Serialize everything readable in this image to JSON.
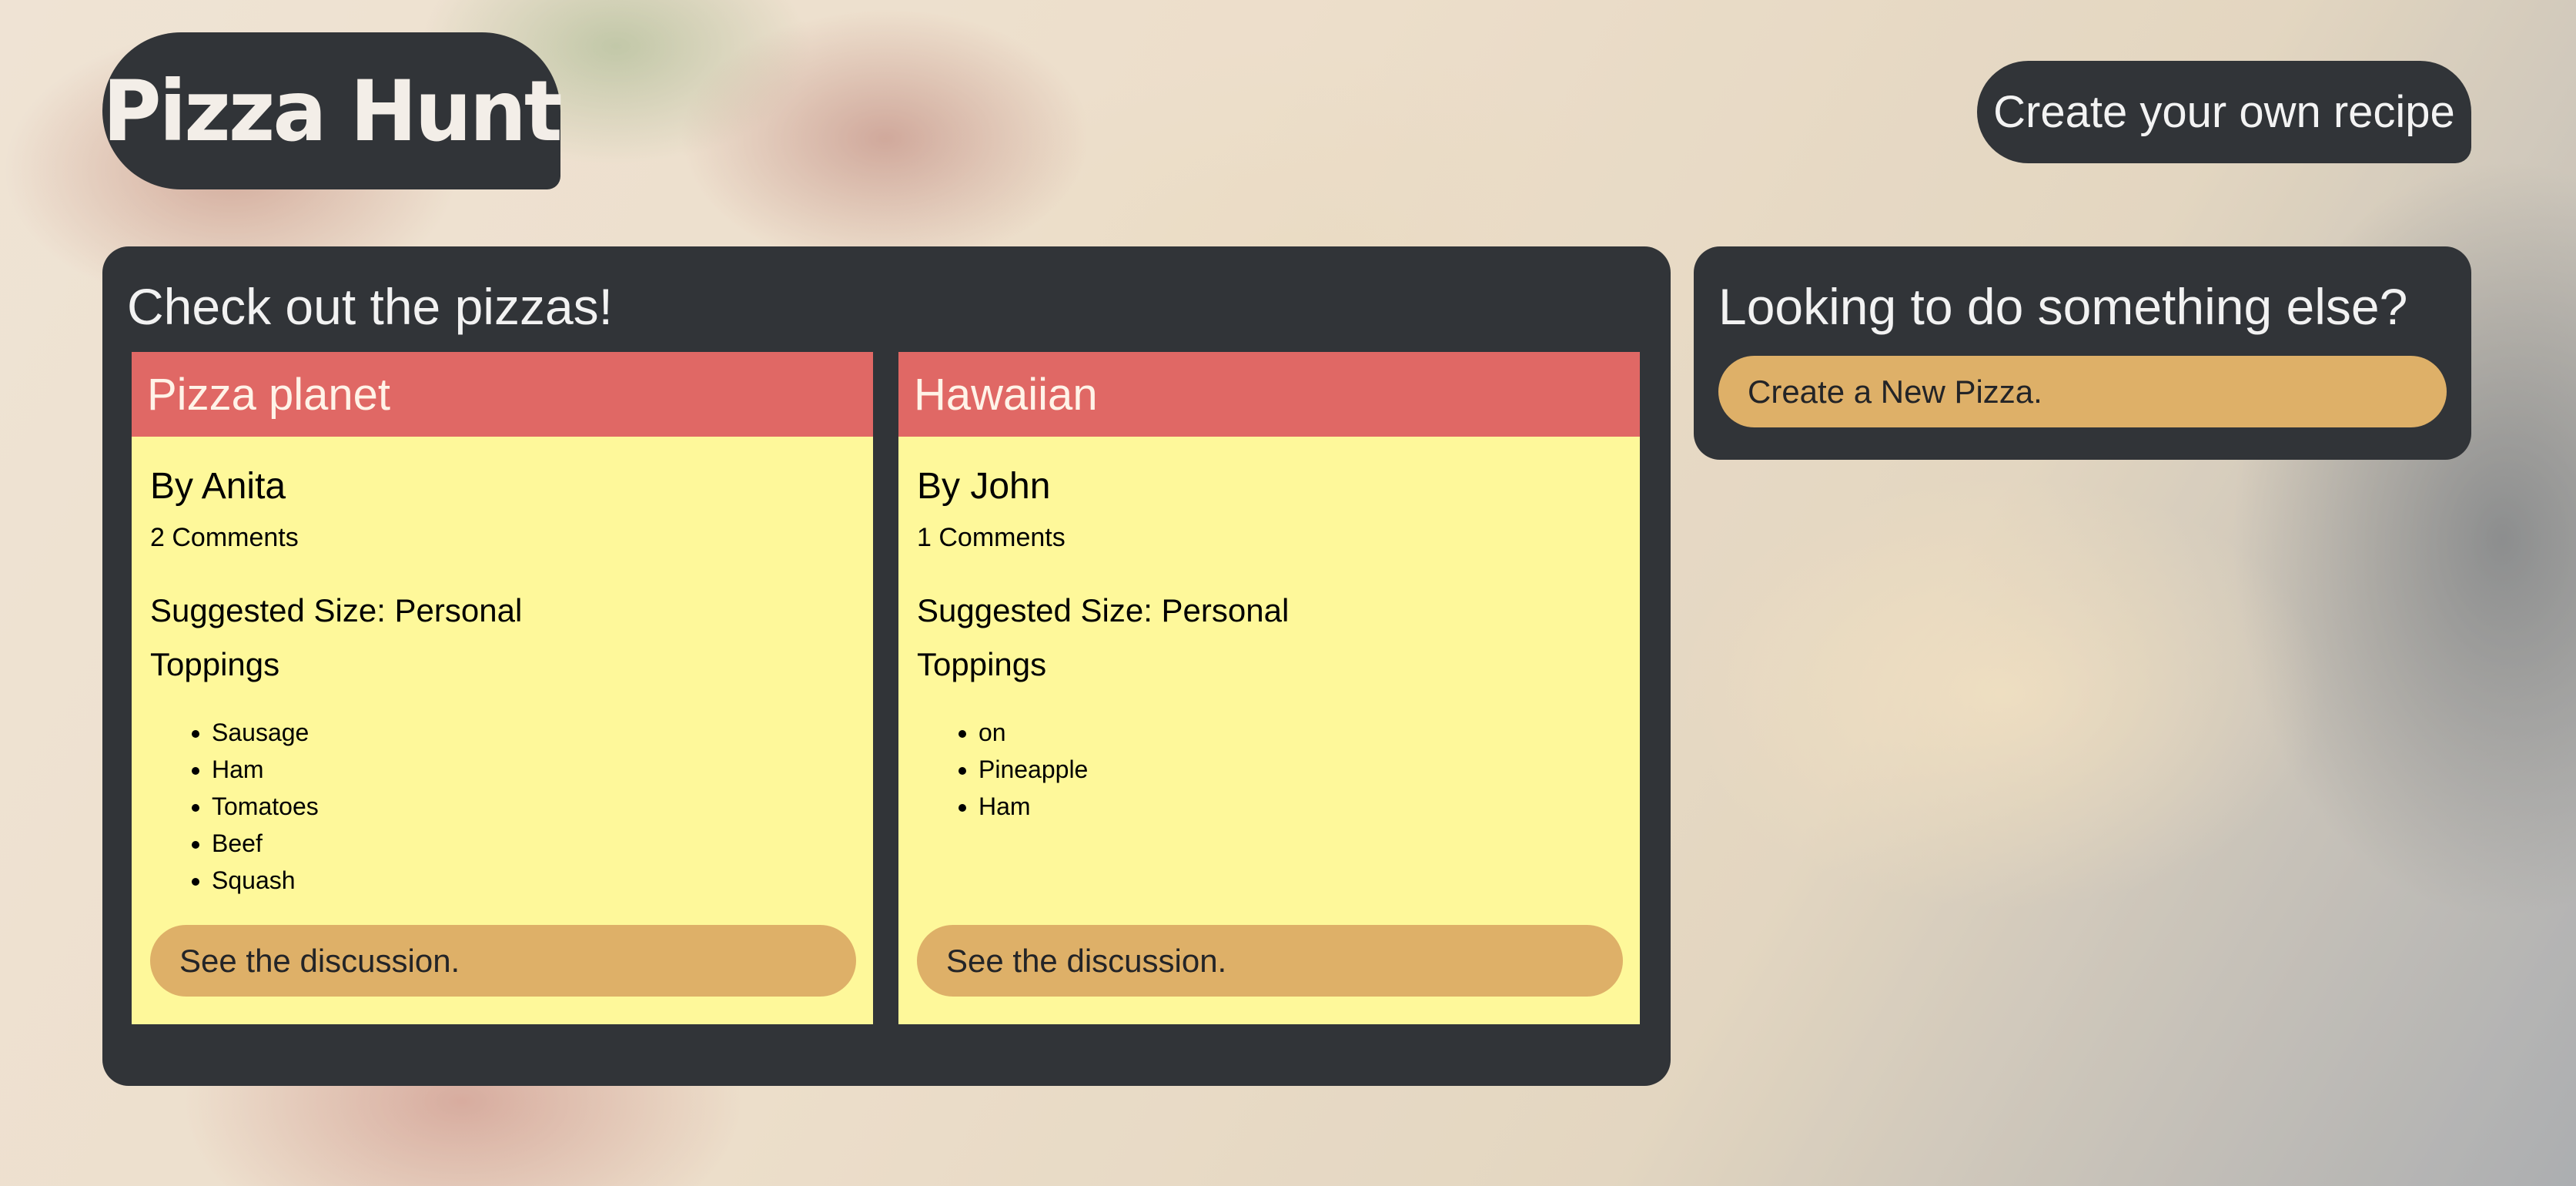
{
  "header": {
    "logo_text": "Pizza Hunt",
    "create_recipe_label": "Create your own recipe"
  },
  "main": {
    "title": "Check out the pizzas!",
    "pizzas": [
      {
        "name": "Pizza planet",
        "author": "By Anita",
        "comments": "2 Comments",
        "size": "Suggested Size: Personal",
        "toppings_label": "Toppings",
        "toppings": [
          "Sausage",
          "Ham",
          "Tomatoes",
          "Beef",
          "Squash"
        ],
        "discussion_label": "See the discussion."
      },
      {
        "name": "Hawaiian",
        "author": "By John",
        "comments": "1 Comments",
        "size": "Suggested Size: Personal",
        "toppings_label": "Toppings",
        "toppings": [
          "on",
          "Pineapple",
          "Ham"
        ],
        "discussion_label": "See the discussion."
      }
    ]
  },
  "side": {
    "title": "Looking to do something else?",
    "create_pizza_label": "Create a New Pizza."
  },
  "colors": {
    "panel": "#313438",
    "card_header": "#e06865",
    "card_body": "#fef89a",
    "button": "#deb068"
  }
}
